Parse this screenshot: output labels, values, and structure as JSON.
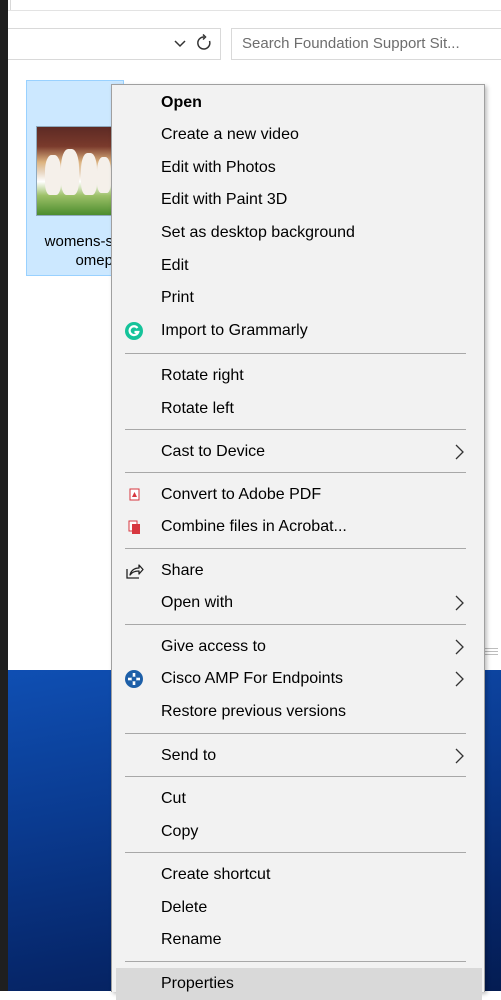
{
  "explorer": {
    "search_placeholder": "Search Foundation Support Sit...",
    "file_name_line1": "womens-s",
    "file_name_line2": "omep"
  },
  "context_menu": {
    "groups": [
      [
        "Open",
        "Create a new video",
        "Edit with Photos",
        "Edit with Paint 3D",
        "Set as desktop background",
        "Edit",
        "Print",
        "Import to Grammarly"
      ],
      [
        "Rotate right",
        "Rotate left"
      ],
      [
        "Cast to Device"
      ],
      [
        "Convert to Adobe PDF",
        "Combine files in Acrobat..."
      ],
      [
        "Share",
        "Open with"
      ],
      [
        "Give access to",
        "Cisco AMP For Endpoints",
        "Restore previous versions"
      ],
      [
        "Send to"
      ],
      [
        "Cut",
        "Copy"
      ],
      [
        "Create shortcut",
        "Delete",
        "Rename"
      ],
      [
        "Properties"
      ]
    ],
    "submenu_items": [
      "Cast to Device",
      "Open with",
      "Give access to",
      "Cisco AMP For Endpoints",
      "Send to"
    ],
    "highlighted_item": "Properties",
    "icons": {
      "Import to Grammarly": "grammarly-icon",
      "Convert to Adobe PDF": "adobe-pdf-icon",
      "Combine files in Acrobat...": "acrobat-combine-icon",
      "Share": "share-icon",
      "Cisco AMP For Endpoints": "cisco-amp-icon"
    }
  },
  "colors": {
    "menu_background": "#f2f2f2",
    "hover_background": "#d9d9d9",
    "selection_background": "#cce8ff",
    "grammarly_green": "#15c39a",
    "adobe_red": "#d7373f",
    "cisco_blue": "#1d5fa8"
  }
}
